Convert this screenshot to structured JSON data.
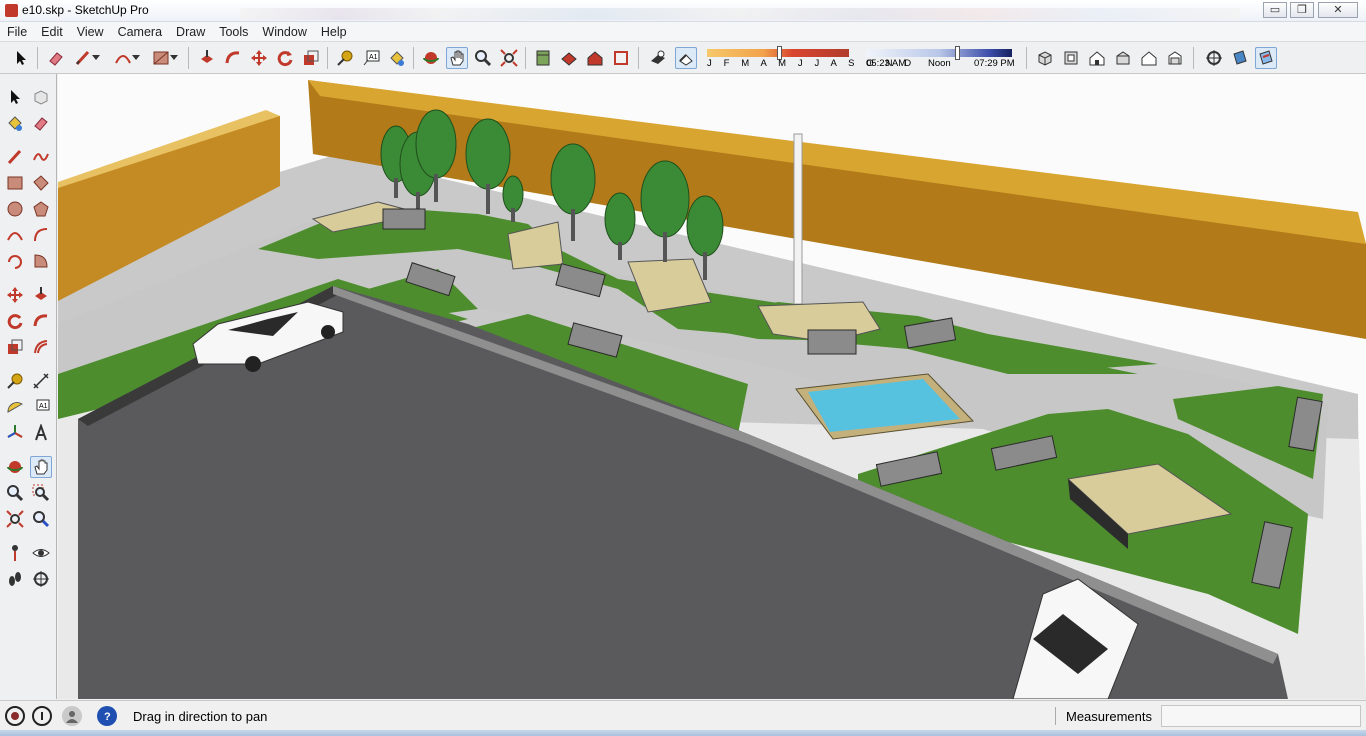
{
  "window": {
    "title": "e10.skp - SketchUp Pro",
    "controls": {
      "minimize": "▭",
      "restore": "❐",
      "close": "✕"
    }
  },
  "menu": [
    "File",
    "Edit",
    "View",
    "Camera",
    "Draw",
    "Tools",
    "Window",
    "Help"
  ],
  "toolbar": {
    "shadow_months": "J F M A M J J A S O N D",
    "time_start": "05:23 AM",
    "time_noon": "Noon",
    "time_end": "07:29 PM",
    "icons": [
      "select-icon",
      "eraser-icon",
      "pencil-icon",
      "arc-icon",
      "rectangle-icon",
      "push-pull-icon",
      "follow-me-icon",
      "move-icon",
      "rotate-icon",
      "scale-icon",
      "tape-measure-icon",
      "text-icon",
      "paint-bucket-icon",
      "orbit-icon",
      "pan-icon",
      "zoom-icon",
      "zoom-extents-icon",
      "components-icon",
      "styles-icon",
      "3d-warehouse-icon",
      "send-to-layout-icon",
      "shadows-icon",
      "fog-icon",
      "iso-view-icon",
      "top-view-icon",
      "front-view-icon",
      "right-view-icon",
      "back-view-icon",
      "left-view-icon",
      "position-camera-icon",
      "section-plane-icon",
      "display-section-icon"
    ]
  },
  "palette": [
    "select-icon",
    "component-icon",
    "paint-bucket-icon",
    "eraser-icon",
    "line-icon",
    "freehand-icon",
    "rectangle-icon",
    "rotated-rectangle-icon",
    "circle-icon",
    "polygon-icon",
    "arc-icon",
    "two-point-arc-icon",
    "three-point-arc-icon",
    "pie-icon",
    "move-icon",
    "push-pull-icon",
    "rotate-icon",
    "follow-me-icon",
    "scale-icon",
    "offset-icon",
    "tape-measure-icon",
    "dimension-icon",
    "protractor-icon",
    "text-icon",
    "axes-icon",
    "3d-text-icon",
    "orbit-icon",
    "pan-icon",
    "zoom-icon",
    "zoom-window-icon",
    "zoom-extents-icon",
    "previous-view-icon",
    "position-camera-icon",
    "look-around-icon",
    "walk-icon",
    "section-plane-icon"
  ],
  "status": {
    "hint": "Drag in direction to pan",
    "measurements_label": "Measurements",
    "measurements_value": ""
  },
  "colors": {
    "wall": "#d7a02d",
    "grass": "#4f8f2e",
    "paving": "#c6c6c6",
    "asphalt": "#5b5b5e",
    "water": "#56c2e0",
    "tree": "#3b8a36"
  }
}
